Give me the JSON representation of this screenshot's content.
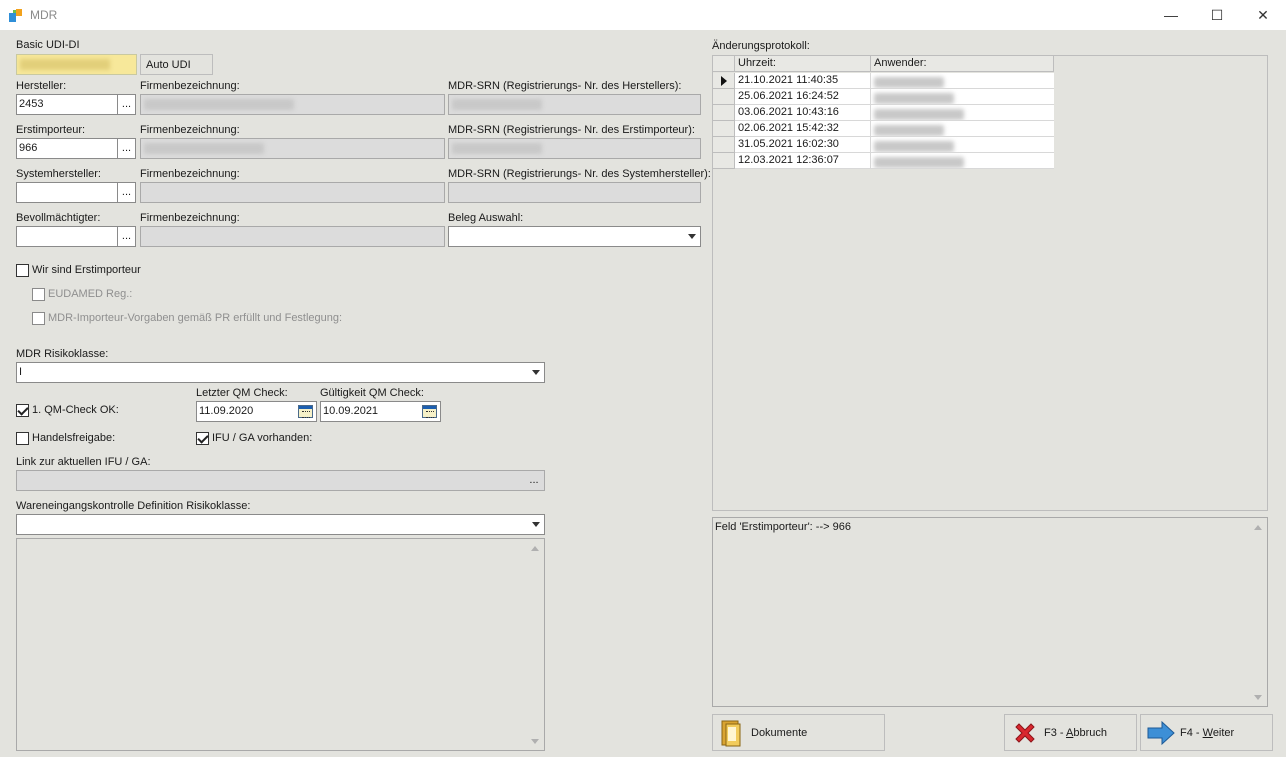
{
  "window": {
    "title": "MDR",
    "minimize": "—",
    "maximize": "☐",
    "close": "✕"
  },
  "form": {
    "basic_udi_label": "Basic UDI-DI",
    "auto_udi_label": "Auto UDI",
    "ellipsis": "...",
    "hersteller": {
      "label": "Hersteller:",
      "value": "2453",
      "firm_label": "Firmenbezeichnung:",
      "srn_label": "MDR-SRN (Registrierungs- Nr. des Herstellers):"
    },
    "erstimporteur": {
      "label": "Erstimporteur:",
      "value": "966",
      "firm_label": "Firmenbezeichnung:",
      "srn_label": "MDR-SRN (Registrierungs- Nr. des Erstimporteur):"
    },
    "systemhersteller": {
      "label": "Systemhersteller:",
      "value": "",
      "firm_label": "Firmenbezeichnung:",
      "srn_label": "MDR-SRN (Registrierungs- Nr. des Systemhersteller):"
    },
    "bevollmaechtigter": {
      "label": "Bevollmächtigter:",
      "value": "",
      "firm_label": "Firmenbezeichnung:",
      "beleg_label": "Beleg Auswahl:",
      "beleg_value": ""
    },
    "wir_sind_erstimporteur": {
      "label": "Wir sind Erstimporteur",
      "checked": false
    },
    "eudamed": {
      "label": "EUDAMED Reg.:",
      "checked": false
    },
    "importeur_vorgaben": {
      "label": "MDR-Importeur-Vorgaben gemäß PR erfüllt und Festlegung:",
      "checked": false
    },
    "risikoklasse": {
      "label": "MDR Risikoklasse:",
      "value": "I"
    },
    "qm_check": {
      "label": "1. QM-Check OK:",
      "checked": true
    },
    "letzter_qm": {
      "label": "Letzter QM Check:",
      "value": "11.09.2020"
    },
    "gueltigkeit_qm": {
      "label": "Gültigkeit QM Check:",
      "value": "10.09.2021"
    },
    "handelsfreigabe": {
      "label": "Handelsfreigabe:",
      "checked": false
    },
    "ifu_ga": {
      "label": "IFU / GA vorhanden:",
      "checked": true
    },
    "link_ifu": {
      "label": "Link zur aktuellen IFU / GA:",
      "value": ""
    },
    "wareneingang": {
      "label": "Wareneingangskontrolle Definition Risikoklasse:",
      "value": "",
      "memo": ""
    }
  },
  "protocol": {
    "label": "Änderungsprotokoll:",
    "columns": [
      "Uhrzeit:",
      "Anwender:"
    ],
    "rows": [
      {
        "time": "21.10.2021 11:40:35"
      },
      {
        "time": "25.06.2021 16:24:52"
      },
      {
        "time": "03.06.2021 10:43:16"
      },
      {
        "time": "02.06.2021 15:42:32"
      },
      {
        "time": "31.05.2021 16:02:30"
      },
      {
        "time": "12.03.2021 12:36:07"
      }
    ],
    "detail": "Feld 'Erstimporteur':  --> 966"
  },
  "buttons": {
    "dokumente": "Dokumente",
    "abbruch_prefix": "F3 - ",
    "abbruch_key": "A",
    "abbruch_rest": "bbruch",
    "weiter_prefix": "F4 - ",
    "weiter_key": "W",
    "weiter_rest": "eiter"
  },
  "colors": {
    "background": "#e3e3de",
    "field_readonly": "#dcdcdc",
    "highlight_yellow": "#f7e89a",
    "abbruch_red": "#d9282f",
    "weiter_blue": "#3d8fd6"
  }
}
